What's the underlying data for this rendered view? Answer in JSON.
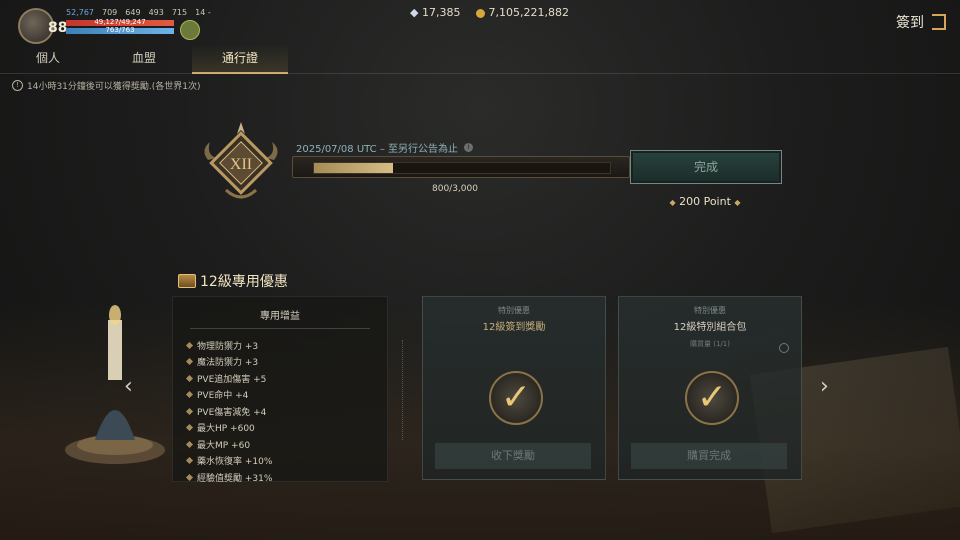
{
  "player": {
    "level": "88",
    "stat_blue": "52,767",
    "stat_2": "709",
    "stat_3": "649",
    "stat_4": "493",
    "stat_5": "715",
    "stat_6": "14 -",
    "hp_text": "49,127/49,247",
    "hp_fraction": 0.998,
    "mp_text": "763/763",
    "mp_fraction": 1.0
  },
  "currency": {
    "diamonds": "17,385",
    "gold": "7,105,221,882"
  },
  "header": {
    "signin_label": "簽到"
  },
  "tabs": [
    {
      "label": "個人",
      "active": false
    },
    {
      "label": "血盟",
      "active": false
    },
    {
      "label": "通行證",
      "active": true
    }
  ],
  "notice": "14小時31分鐘後可以獲得獎勵.(各世界1次)",
  "pass": {
    "emblem_numeral": "XII",
    "date": "2025/07/08 UTC – 至另行公告為止",
    "progress_text": "800/3,000",
    "progress_fraction": 0.2667,
    "complete_label": "完成",
    "points_label": "200 Point"
  },
  "section": {
    "title": "12級專用優惠",
    "buff_header": "專用增益",
    "buffs": [
      "物理防禦力 +3",
      "魔法防禦力 +3",
      "PVE追加傷害 +5",
      "PVE命中 +4",
      "PVE傷害減免 +4",
      "最大HP +600",
      "最大MP +60",
      "藥水恢復率 +10%",
      "經驗值獎勵 +31%"
    ]
  },
  "cards": [
    {
      "subtitle": "特別優惠",
      "title": "12級簽到獎勵",
      "button_label": "收下獎勵",
      "extra": ""
    },
    {
      "subtitle": "特別優惠",
      "title": "12級特別組合包",
      "button_label": "購買完成",
      "extra": "購買量 (1/1)"
    }
  ],
  "colors": {
    "accent_gold": "#c9a867",
    "hp_red": "#c23530",
    "mp_blue": "#3d7fb8",
    "complete_green": "#28423d"
  }
}
